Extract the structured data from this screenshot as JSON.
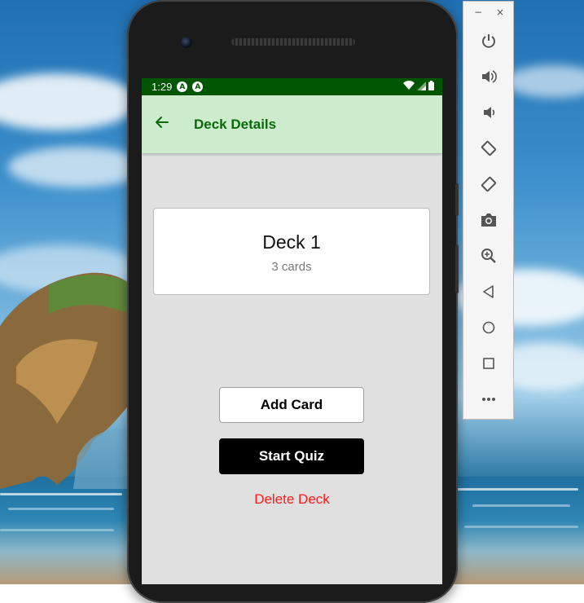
{
  "status_bar": {
    "time": "1:29",
    "notification_icons": [
      "A",
      "A"
    ]
  },
  "app_bar": {
    "title": "Deck Details",
    "back_icon": "arrow-left-icon"
  },
  "deck": {
    "name": "Deck 1",
    "card_count": "3 cards"
  },
  "actions": {
    "add_card_label": "Add Card",
    "start_quiz_label": "Start Quiz",
    "delete_deck_label": "Delete Deck"
  },
  "colors": {
    "status_bar": "#005500",
    "app_bar": "#cdebcd",
    "title": "#0a6a0a",
    "delete": "#ff1a1a",
    "screen_bg": "#e0e0e0"
  },
  "emulator_toolbar": {
    "window_controls": {
      "minimize": "−",
      "close": "×"
    },
    "buttons": [
      {
        "name": "power-icon"
      },
      {
        "name": "volume-up-icon"
      },
      {
        "name": "volume-down-icon"
      },
      {
        "name": "rotate-left-icon"
      },
      {
        "name": "rotate-right-icon"
      },
      {
        "name": "camera-icon"
      },
      {
        "name": "zoom-icon"
      },
      {
        "name": "back-icon"
      },
      {
        "name": "home-icon"
      },
      {
        "name": "overview-icon"
      },
      {
        "name": "more-icon"
      }
    ]
  }
}
